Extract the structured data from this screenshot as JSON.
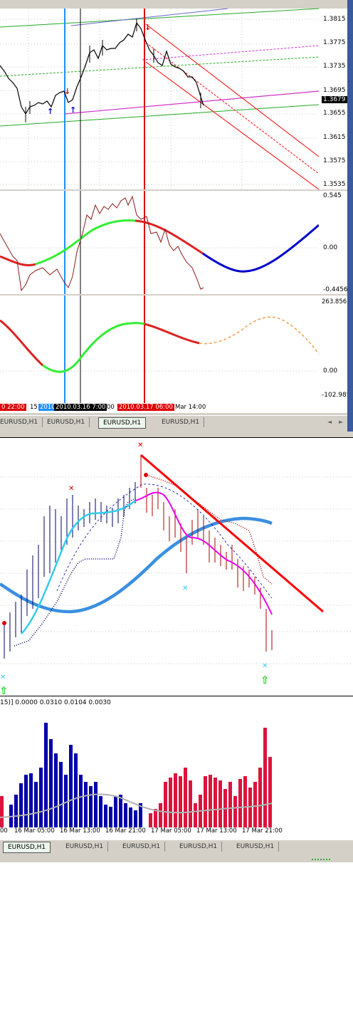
{
  "top_window": {
    "price_scale": [
      "1.3815",
      "1.3775",
      "1.3735",
      "1.3695",
      "1.3655",
      "1.3615",
      "1.3575",
      "1.3535"
    ],
    "current_price": "1.3679",
    "osc1_scale": [
      "0.545",
      "0.00",
      "-0.4456"
    ],
    "osc2_scale": [
      "263.8561",
      "0.00",
      "-102.985"
    ],
    "time_axis": {
      "t1": "0 22:00",
      "t2": "15",
      "t3": "2010",
      "t4": "2010.03.16 7:00",
      "t5": "00",
      "t6": "2010.03.17 06:00",
      "t7": "Mar 14:00"
    },
    "tabs": [
      "EURUSD,H1",
      "EURUSD,H1",
      "EURUSD,H1",
      "EURUSD,H1"
    ],
    "active_tab": 2,
    "scroll_left": "◄",
    "scroll_right": "►"
  },
  "bottom_window": {
    "indicator_label": "15)] 0.0000 0.0310 0.0104 0.0030",
    "time_axis": [
      "00",
      "16 Mar 05:00",
      "16 Mar 13:00",
      "16 Mar 21:00",
      "17 Mar 05:00",
      "17 Mar 13:00",
      "17 Mar 21:00"
    ],
    "tabs": [
      "EURUSD,H1",
      "EURUSD,H1",
      "EURUSD,H1",
      "EURUSD,H1",
      "EURUSD,H1"
    ],
    "active_tab": 0
  },
  "colors": {
    "bull": "#0000cc",
    "bear": "#dc143c",
    "trend_red": "#ff0000",
    "blue_vline": "#1e90ff",
    "ma_blue": "#3b8fe0",
    "lime": "#33ee33",
    "magenta": "#ee00ee",
    "cyan": "#33ccee"
  }
}
